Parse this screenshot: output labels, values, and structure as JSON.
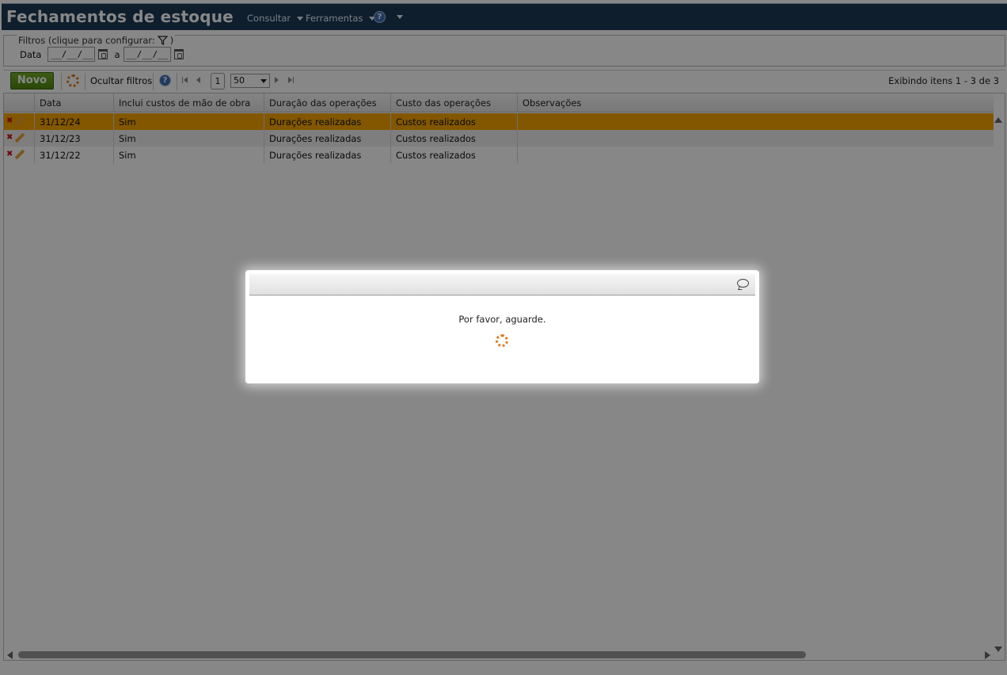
{
  "header": {
    "title": "Fechamentos de estoque",
    "menu_consultar": "Consultar",
    "menu_ferramentas": "Ferramentas",
    "help_glyph": "?"
  },
  "filters": {
    "legend": "Filtros (clique para configurar:",
    "legend_close": ")",
    "date_label": "Data",
    "date_from": "__/__/__",
    "separator": "a",
    "date_to": "__/__/__"
  },
  "toolbar": {
    "new_label": "Novo",
    "hide_filters_label": "Ocultar filtros",
    "page_number": "1",
    "page_size": "50",
    "status": "Exibindo itens 1 - 3 de 3"
  },
  "grid": {
    "columns": [
      "Data",
      "Inclui custos de mão de obra",
      "Duração das operações",
      "Custo das operações",
      "Observações"
    ],
    "rows": [
      {
        "data": "31/12/24",
        "mao_obra": "Sim",
        "duracao": "Durações realizadas",
        "custo": "Custos realizados",
        "obs": ""
      },
      {
        "data": "31/12/23",
        "mao_obra": "Sim",
        "duracao": "Durações realizadas",
        "custo": "Custos realizados",
        "obs": ""
      },
      {
        "data": "31/12/22",
        "mao_obra": "Sim",
        "duracao": "Durações realizadas",
        "custo": "Custos realizados",
        "obs": ""
      }
    ],
    "selected_row_color": "#f5a400"
  },
  "modal": {
    "message": "Por favor, aguarde."
  },
  "colors": {
    "title_bar": "#1b3a56",
    "new_button": "#5e9a18",
    "spinner": "#e07b1a"
  }
}
